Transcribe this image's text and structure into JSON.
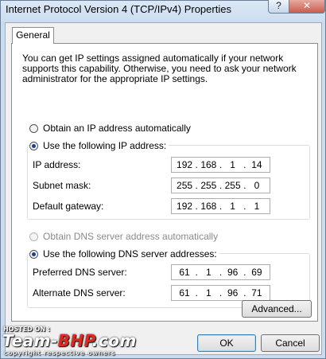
{
  "window": {
    "title": "Internet Protocol Version 4 (TCP/IPv4) Properties",
    "help_label": "?",
    "close_label": "✕"
  },
  "tabs": [
    {
      "label": "General"
    }
  ],
  "general": {
    "intro": "You can get IP settings assigned automatically if your network supports this capability. Otherwise, you need to ask your network administrator for the appropriate IP settings.",
    "ip_auto_label": "Obtain an IP address automatically",
    "ip_manual_label": "Use the following IP address:",
    "ip_fields": [
      {
        "label": "IP address:",
        "octets": [
          "192",
          "168",
          "1",
          "14"
        ]
      },
      {
        "label": "Subnet mask:",
        "octets": [
          "255",
          "255",
          "255",
          "0"
        ]
      },
      {
        "label": "Default gateway:",
        "octets": [
          "192",
          "168",
          "1",
          "1"
        ]
      }
    ],
    "dns_auto_label": "Obtain DNS server address automatically",
    "dns_manual_label": "Use the following DNS server addresses:",
    "dns_fields": [
      {
        "label": "Preferred DNS server:",
        "octets": [
          "61",
          "1",
          "96",
          "69"
        ]
      },
      {
        "label": "Alternate DNS server:",
        "octets": [
          "61",
          "1",
          "96",
          "71"
        ]
      }
    ],
    "advanced_label": "Advanced..."
  },
  "footer": {
    "ok_label": "OK",
    "cancel_label": "Cancel"
  },
  "watermark": {
    "hosted": "HOSTED ON :",
    "brand_a": "Team-",
    "brand_b": "BHP",
    "brand_c": ".com",
    "copyright": "copyright respective owners"
  },
  "colors": {
    "selected_radio": "#1b3f8f",
    "brand_red": "#e0281f",
    "disabled_text": "#8a8a8a"
  }
}
